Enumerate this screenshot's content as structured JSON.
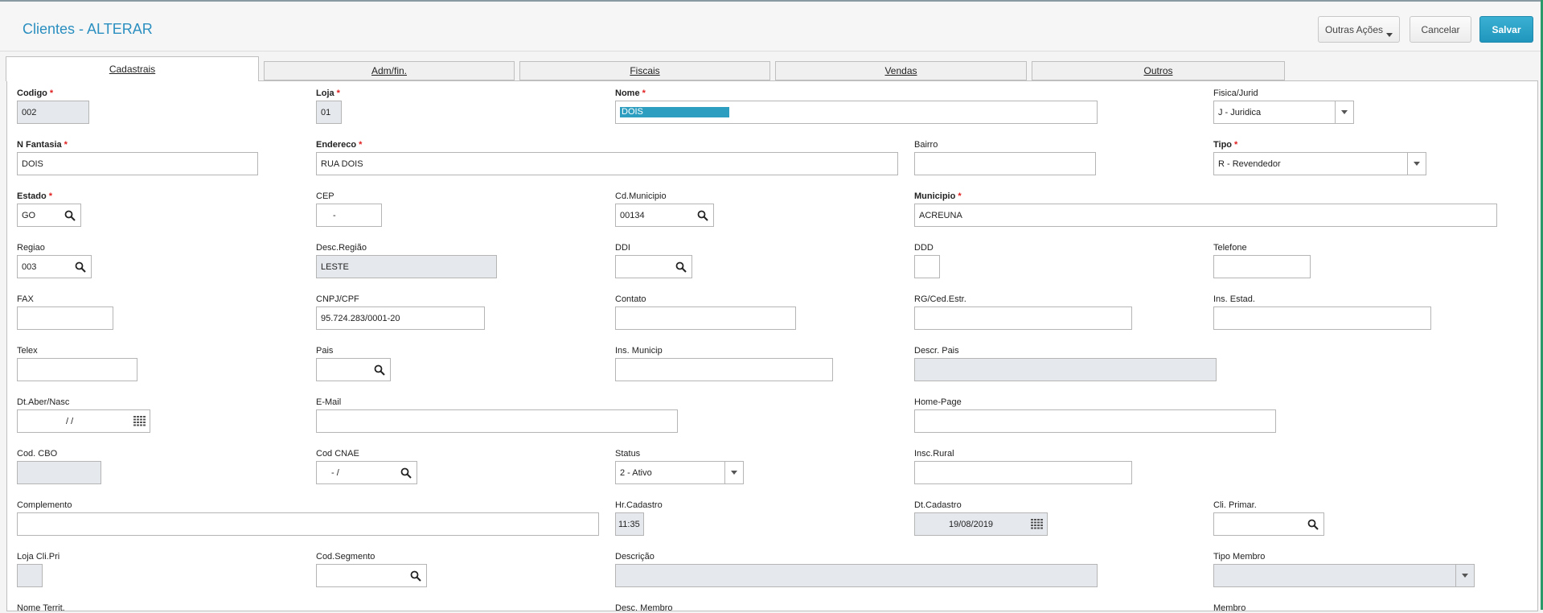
{
  "header": {
    "title": "Clientes - ALTERAR",
    "actions_label": "Outras Ações",
    "cancel_label": "Cancelar",
    "save_label": "Salvar"
  },
  "tabs": [
    "Cadastrais",
    "Adm/fin.",
    "Fiscais",
    "Vendas",
    "Outros"
  ],
  "fields": {
    "codigo": {
      "label": "Codigo",
      "value": "002"
    },
    "loja": {
      "label": "Loja",
      "value": "01"
    },
    "nome": {
      "label": "Nome",
      "value": "DOIS"
    },
    "fisica": {
      "label": "Fisica/Jurid",
      "value": "J - Juridica"
    },
    "nfantasia": {
      "label": "N Fantasia",
      "value": "DOIS"
    },
    "endereco": {
      "label": "Endereco",
      "value": "RUA DOIS"
    },
    "bairro": {
      "label": "Bairro",
      "value": ""
    },
    "tipo": {
      "label": "Tipo",
      "value": "R - Revendedor"
    },
    "estado": {
      "label": "Estado",
      "value": "GO"
    },
    "cep": {
      "label": "CEP",
      "value": "-"
    },
    "cdmunicipio": {
      "label": "Cd.Municipio",
      "value": "00134"
    },
    "municipio": {
      "label": "Municipio",
      "value": "ACREUNA"
    },
    "regiao": {
      "label": "Regiao",
      "value": "003"
    },
    "descregiao": {
      "label": "Desc.Região",
      "value": "LESTE"
    },
    "ddi": {
      "label": "DDI",
      "value": ""
    },
    "ddd": {
      "label": "DDD",
      "value": ""
    },
    "telefone": {
      "label": "Telefone",
      "value": ""
    },
    "fax": {
      "label": "FAX",
      "value": ""
    },
    "cnpj": {
      "label": "CNPJ/CPF",
      "value": "95.724.283/0001-20"
    },
    "contato": {
      "label": "Contato",
      "value": ""
    },
    "rg": {
      "label": "RG/Ced.Estr.",
      "value": ""
    },
    "insestad": {
      "label": "Ins. Estad.",
      "value": ""
    },
    "telex": {
      "label": "Telex",
      "value": ""
    },
    "pais": {
      "label": "Pais",
      "value": ""
    },
    "insmunicip": {
      "label": "Ins. Municip",
      "value": ""
    },
    "descrpais": {
      "label": "Descr. Pais",
      "value": ""
    },
    "dtaber": {
      "label": "Dt.Aber/Nasc",
      "value": "/  /"
    },
    "email": {
      "label": "E-Mail",
      "value": ""
    },
    "homepage": {
      "label": "Home-Page",
      "value": ""
    },
    "codcbo": {
      "label": "Cod. CBO",
      "value": ""
    },
    "codcnae": {
      "label": "Cod CNAE",
      "value": "- /"
    },
    "status": {
      "label": "Status",
      "value": "2 - Ativo"
    },
    "inscrural": {
      "label": "Insc.Rural",
      "value": ""
    },
    "complemento": {
      "label": "Complemento",
      "value": ""
    },
    "hrcadastro": {
      "label": "Hr.Cadastro",
      "value": "11:35"
    },
    "dtcadastro": {
      "label": "Dt.Cadastro",
      "value": "19/08/2019"
    },
    "cliprimar": {
      "label": "Cli. Primar.",
      "value": ""
    },
    "lojacli": {
      "label": "Loja Cli.Pri",
      "value": ""
    },
    "codsegmento": {
      "label": "Cod.Segmento",
      "value": ""
    },
    "descricao": {
      "label": "Descrição",
      "value": ""
    },
    "tipomembro": {
      "label": "Tipo Membro",
      "value": ""
    },
    "nometerrit": {
      "label": "Nome Territ.",
      "value": ""
    },
    "descmembro": {
      "label": "Desc. Membro",
      "value": ""
    },
    "membro": {
      "label": "Membro",
      "value": ""
    }
  },
  "colors": {
    "accent": "#2b8fc0",
    "primary_button": "#2196bd",
    "readonly_bg": "#e5e8ed",
    "required": "#e02020"
  }
}
